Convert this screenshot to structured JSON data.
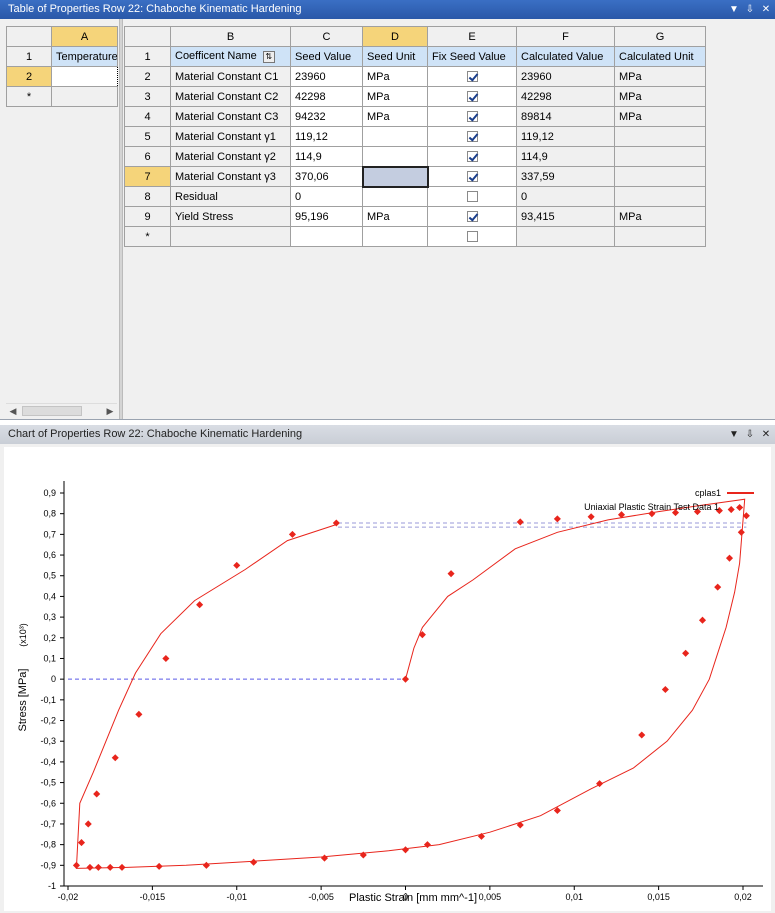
{
  "table_window": {
    "title": "Table of Properties Row 22: Chaboche Kinematic Hardening",
    "controls": {
      "dropdown": "▼",
      "pin": "⇩",
      "close": "✕"
    }
  },
  "left_table": {
    "col_letter": "A",
    "rows": [
      {
        "num": "1",
        "value": "Temperature"
      },
      {
        "num": "2",
        "value": ""
      },
      {
        "num": "*",
        "value": ""
      }
    ]
  },
  "main_table": {
    "col_letters": [
      "B",
      "C",
      "D",
      "E",
      "F",
      "G"
    ],
    "header_row_num": "1",
    "headers": [
      "Coefficent Name",
      "Seed Value",
      "Seed Unit",
      "Fix Seed Value",
      "Calculated Value",
      "Calculated Unit"
    ],
    "rows": [
      {
        "num": "2",
        "name": "Material Constant C1",
        "seed": "23960",
        "seed_unit": "MPa",
        "fix": true,
        "calc": "23960",
        "calc_unit": "MPa"
      },
      {
        "num": "3",
        "name": "Material Constant C2",
        "seed": "42298",
        "seed_unit": "MPa",
        "fix": true,
        "calc": "42298",
        "calc_unit": "MPa"
      },
      {
        "num": "4",
        "name": "Material Constant C3",
        "seed": "94232",
        "seed_unit": "MPa",
        "fix": true,
        "calc": "89814",
        "calc_unit": "MPa"
      },
      {
        "num": "5",
        "name": "Material Constant γ1",
        "seed": "119,12",
        "seed_unit": "",
        "fix": true,
        "calc": "119,12",
        "calc_unit": ""
      },
      {
        "num": "6",
        "name": "Material Constant γ2",
        "seed": "114,9",
        "seed_unit": "",
        "fix": true,
        "calc": "114,9",
        "calc_unit": ""
      },
      {
        "num": "7",
        "name": "Material Constant γ3",
        "seed": "370,06",
        "seed_unit": "",
        "fix": true,
        "calc": "337,59",
        "calc_unit": ""
      },
      {
        "num": "8",
        "name": "Residual",
        "seed": "0",
        "seed_unit": "",
        "fix": false,
        "calc": "0",
        "calc_unit": ""
      },
      {
        "num": "9",
        "name": "Yield Stress",
        "seed": "95,196",
        "seed_unit": "MPa",
        "fix": true,
        "calc": "93,415",
        "calc_unit": "MPa"
      },
      {
        "num": "*",
        "name": "",
        "seed": "",
        "seed_unit": "",
        "fix": false,
        "calc": "",
        "calc_unit": ""
      }
    ]
  },
  "chart_window": {
    "title": "Chart of Properties Row 22: Chaboche Kinematic Hardening",
    "controls": {
      "dropdown": "▼",
      "pin": "⇩",
      "close": "✕"
    }
  },
  "chart_data": {
    "type": "line",
    "xlabel": "Plastic Strain  [mm mm^-1]",
    "ylabel": "Stress  [MPa]",
    "y_multiplier": "(x10³)",
    "xlim": [
      -0.02,
      0.02
    ],
    "ylim": [
      -1,
      0.9
    ],
    "x_ticks": [
      "-0,02",
      "-0,015",
      "-0,01",
      "-0,005",
      "0",
      "0,005",
      "0,01",
      "0,015",
      "0,02"
    ],
    "y_ticks": [
      "-1",
      "-0,9",
      "-0,8",
      "-0,7",
      "-0,6",
      "-0,5",
      "-0,4",
      "-0,3",
      "-0,2",
      "-0,1",
      "0",
      "0,1",
      "0,2",
      "0,3",
      "0,4",
      "0,5",
      "0,6",
      "0,7",
      "0,8",
      "0,9"
    ],
    "grid": false,
    "legend_position": "top-right",
    "series": [
      {
        "name": "cplas1",
        "style": "line",
        "color": "#e8251c",
        "points": [
          [
            0,
            0
          ],
          [
            0.0005,
            0.15
          ],
          [
            0.001,
            0.25
          ],
          [
            0.0015,
            0.3
          ],
          [
            0.0025,
            0.4
          ],
          [
            0.004,
            0.48
          ],
          [
            0.0065,
            0.63
          ],
          [
            0.009,
            0.71
          ],
          [
            0.012,
            0.77
          ],
          [
            0.015,
            0.81
          ],
          [
            0.0175,
            0.84
          ],
          [
            0.0201,
            0.87
          ],
          [
            0.0198,
            0.56
          ],
          [
            0.0195,
            0.42
          ],
          [
            0.019,
            0.25
          ],
          [
            0.018,
            0.0
          ],
          [
            0.017,
            -0.15
          ],
          [
            0.0155,
            -0.3
          ],
          [
            0.0135,
            -0.43
          ],
          [
            0.011,
            -0.53
          ],
          [
            0.008,
            -0.66
          ],
          [
            0.005,
            -0.74
          ],
          [
            0.002,
            -0.8
          ],
          [
            -0.001,
            -0.83
          ],
          [
            -0.005,
            -0.86
          ],
          [
            -0.009,
            -0.88
          ],
          [
            -0.013,
            -0.9
          ],
          [
            -0.0165,
            -0.91
          ],
          [
            -0.0195,
            -0.915
          ],
          [
            -0.0193,
            -0.6
          ],
          [
            -0.0185,
            -0.45
          ],
          [
            -0.017,
            -0.15
          ],
          [
            -0.016,
            0.03
          ],
          [
            -0.0145,
            0.22
          ],
          [
            -0.0125,
            0.38
          ],
          [
            -0.0095,
            0.53
          ],
          [
            -0.007,
            0.67
          ],
          [
            -0.004,
            0.75
          ]
        ]
      },
      {
        "name": "Uniaxial Plastic Strain Test Data 1",
        "style": "markers",
        "color": "#e8251c",
        "points": [
          [
            0,
            0
          ],
          [
            0.001,
            0.215
          ],
          [
            0.0027,
            0.51
          ],
          [
            0.0068,
            0.76
          ],
          [
            0.009,
            0.775
          ],
          [
            0.011,
            0.785
          ],
          [
            0.0128,
            0.795
          ],
          [
            0.0146,
            0.8
          ],
          [
            0.016,
            0.805
          ],
          [
            0.0173,
            0.81
          ],
          [
            0.0186,
            0.815
          ],
          [
            0.0193,
            0.82
          ],
          [
            0.0198,
            0.83
          ],
          [
            0.0202,
            0.79
          ],
          [
            0.0199,
            0.71
          ],
          [
            0.0192,
            0.585
          ],
          [
            0.0185,
            0.445
          ],
          [
            0.0176,
            0.285
          ],
          [
            0.0166,
            0.125
          ],
          [
            0.0154,
            -0.05
          ],
          [
            0.014,
            -0.27
          ],
          [
            0.0115,
            -0.505
          ],
          [
            0.009,
            -0.635
          ],
          [
            0.0068,
            -0.705
          ],
          [
            0.0045,
            -0.76
          ],
          [
            0.0013,
            -0.8
          ],
          [
            0.0,
            -0.825
          ],
          [
            -0.0025,
            -0.85
          ],
          [
            -0.0048,
            -0.865
          ],
          [
            -0.009,
            -0.885
          ],
          [
            -0.0118,
            -0.9
          ],
          [
            -0.0146,
            -0.905
          ],
          [
            -0.0175,
            -0.91
          ],
          [
            -0.0168,
            -0.91
          ],
          [
            -0.0182,
            -0.91
          ],
          [
            -0.0187,
            -0.91
          ],
          [
            -0.0195,
            -0.9
          ],
          [
            -0.0192,
            -0.79
          ],
          [
            -0.0188,
            -0.7
          ],
          [
            -0.0183,
            -0.555
          ],
          [
            -0.0172,
            -0.38
          ],
          [
            -0.0158,
            -0.17
          ],
          [
            -0.0142,
            0.1
          ],
          [
            -0.0122,
            0.36
          ],
          [
            -0.01,
            0.55
          ],
          [
            -0.0067,
            0.7
          ],
          [
            -0.0041,
            0.755
          ]
        ]
      }
    ],
    "reference_lines": {
      "color": "#5a5ae6",
      "zero_level_x_range": [
        -0.02,
        0
      ],
      "upper_levels": [
        0.755,
        0.735
      ],
      "upper_x_range": [
        -0.004,
        0.0202
      ]
    }
  }
}
